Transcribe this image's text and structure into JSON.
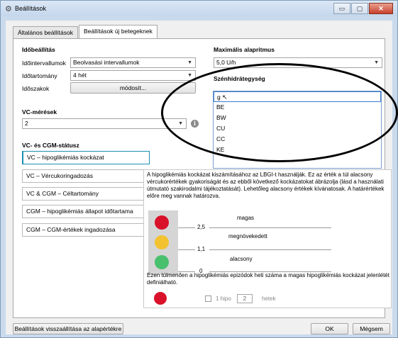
{
  "window": {
    "title": "Beállítások",
    "controls": [
      "▭",
      "▢",
      "✕"
    ]
  },
  "tabs": [
    {
      "label": "Általános beállítások"
    },
    {
      "label": "Beállítások új betegeknek"
    }
  ],
  "time_settings": {
    "section_title": "Időbeállítás",
    "interval_label": "Időintervallumok",
    "interval_value": "Beolvasási intervallumok",
    "range_label": "Időtartomány",
    "range_value": "4 hét",
    "periods_label": "Időszakok",
    "modify_button": "módosít..."
  },
  "bg_measurements": {
    "title": "VC-mérések",
    "value": "2"
  },
  "status": {
    "title": "VC- és CGM-státusz",
    "items": [
      "VC – hipoglikémiás kockázat",
      "VC – Vércukoringadozás",
      "VC & CGM – Céltartomány",
      "CGM – hipoglikémiás állapot időtartama",
      "CGM – CGM-értékek ingadozása"
    ]
  },
  "basal_rate": {
    "title": "Maximális alapritmus",
    "value": "5,0 U/h"
  },
  "carb_unit": {
    "title": "Szénhidrátegység",
    "current": "g",
    "options": [
      "g",
      "BE",
      "BW",
      "CU",
      "CC",
      "KE"
    ]
  },
  "tooltip": {
    "text": "A hipoglikémiás kockázat kiszámításához az LBGI-t használják. Ez az érték a túl alacsony vércukorértékek gyakoriságát és az ebből következő kockázatokat ábrázolja (lásd a használati útmutató szakirodalmi tájékoztatását). Lehetőleg alacsony értékek kívánatosak. A határértékek előre meg vannak határozva.",
    "levels": {
      "high": "magas",
      "elevated": "megnövekedett",
      "low": "alacsony"
    },
    "thresholds": {
      "t1": "2,5",
      "t2": "1,1",
      "t3": "0"
    },
    "episodes_text": "Ezen túlmenően a hipoglikémiás epizódok heti száma a magas hipoglikémiás kockázat jelenlétét definiálható.",
    "hypo_label": "1 hipo",
    "weeks_value": "2",
    "weeks_label": "hetek"
  },
  "footer": {
    "reset_button": "Beállítások visszaállítása az alapértékre",
    "ok_button": "OK",
    "cancel_button": "Mégsem"
  },
  "colors": {
    "red": "#d9122a",
    "yellow": "#f2c230",
    "green": "#49c06e",
    "accent": "#1a8fb0"
  }
}
